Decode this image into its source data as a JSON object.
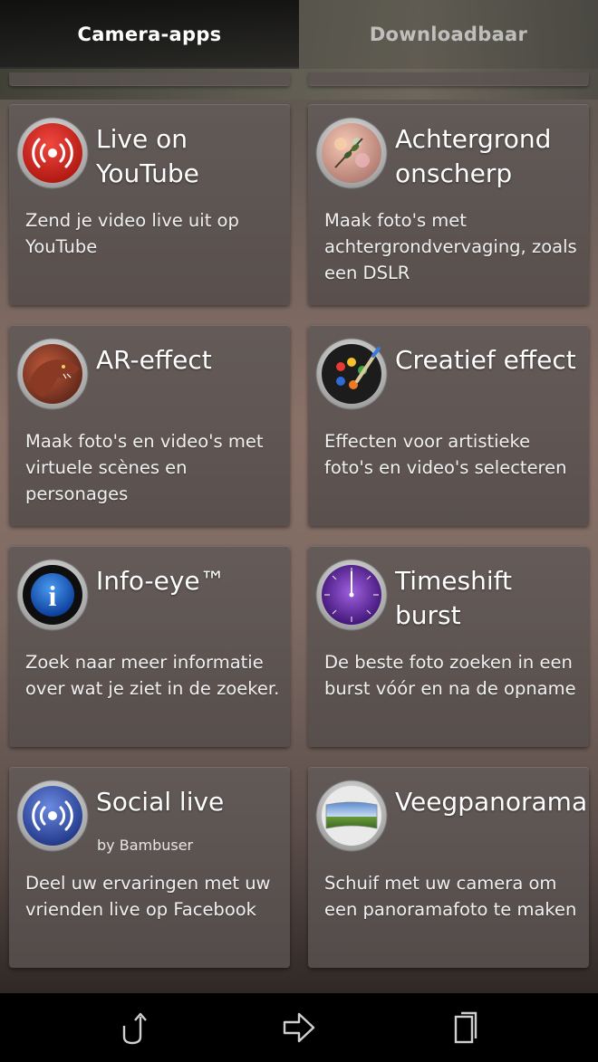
{
  "tabs": [
    {
      "label": "Camera-apps",
      "active": true
    },
    {
      "label": "Downloadbaar",
      "active": false
    }
  ],
  "apps": [
    {
      "title": "Live on YouTube",
      "description": "Zend je video live uit op YouTube",
      "icon": "live-broadcast-icon"
    },
    {
      "title": "Achtergrond onscherp",
      "description": "Maak foto's met achtergrondvervaging, zoals een DSLR",
      "icon": "bokeh-icon"
    },
    {
      "title": "AR-effect",
      "description": "Maak foto's en video's met virtuele scènes en personages",
      "icon": "dinosaur-icon"
    },
    {
      "title": "Creatief effect",
      "description": "Effecten voor artistieke foto's en video's selecteren",
      "icon": "palette-icon"
    },
    {
      "title": "Info-eye™",
      "description": "Zoek naar meer informatie over wat je ziet in de zoeker.",
      "icon": "info-icon"
    },
    {
      "title": "Timeshift burst",
      "description": "De beste foto zoeken in een burst vóór en na de opname",
      "icon": "clock-burst-icon"
    },
    {
      "title": "Social live",
      "subtitle": "by Bambuser",
      "description": "Deel uw ervaringen met uw vrienden live op Facebook",
      "icon": "social-broadcast-icon"
    },
    {
      "title": "Veegpanorama",
      "description": "Schuif met uw camera om een panoramafoto te maken",
      "icon": "panorama-icon"
    }
  ],
  "navbar": {
    "back_icon": "back-icon",
    "home_icon": "home-icon",
    "recents_icon": "recent-apps-icon"
  },
  "colors": {
    "youtube_red": "#d42a22",
    "info_blue": "#1a5fc4",
    "timeshift_purple": "#6a2aa8",
    "social_blue": "#3a5ab8"
  }
}
